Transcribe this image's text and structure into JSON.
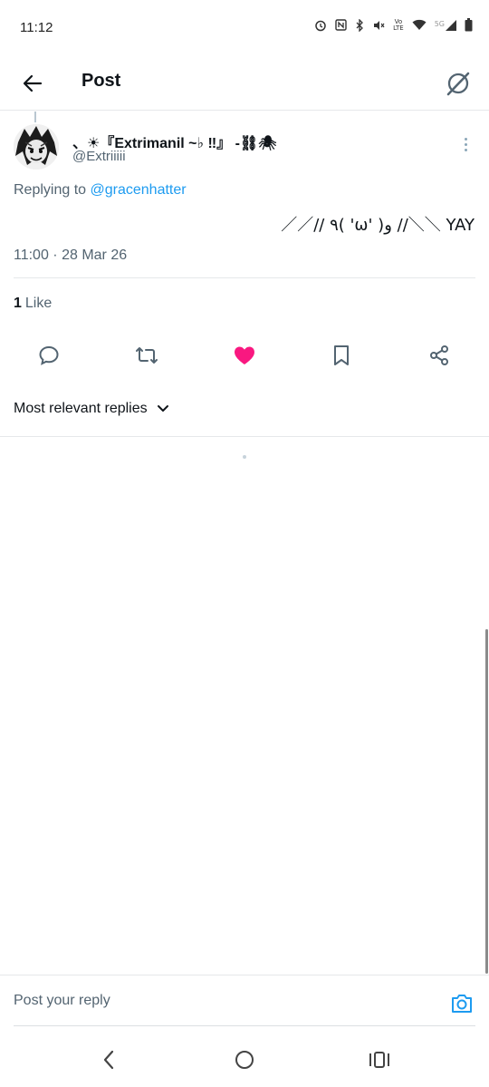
{
  "status_bar": {
    "time": "11:12",
    "volte_top": "Vo",
    "volte_bottom": "LTE",
    "network_label": "5G",
    "icons": [
      "alarm-icon",
      "nfc-icon",
      "bluetooth-icon",
      "mute-icon",
      "volte-icon",
      "wifi-icon",
      "signal-icon",
      "battery-icon"
    ]
  },
  "header": {
    "title": "Post",
    "back_icon": "arrow-left-icon",
    "grok_icon": "grok-icon"
  },
  "tweet": {
    "author_name": "、☀『Extrimanil ~♭ ‼』 -⛓🕷",
    "author_handle": "@Extriiiii",
    "replying_prefix": "Replying to ",
    "replying_to": "@gracenhatter",
    "text": "／／// ٩( 'ω' )و //＼＼ YAY",
    "timestamp": "11:00 · 28 Mar 26",
    "likes_count": "1",
    "likes_label": "Like",
    "liked": true
  },
  "actions": [
    {
      "name": "reply",
      "icon": "comment-icon"
    },
    {
      "name": "repost",
      "icon": "repost-icon"
    },
    {
      "name": "like",
      "icon": "heart-filled-icon"
    },
    {
      "name": "bookmark",
      "icon": "bookmark-icon"
    },
    {
      "name": "share",
      "icon": "share-icon"
    }
  ],
  "sort": {
    "label": "Most relevant replies"
  },
  "reply_bar": {
    "placeholder": "Post your reply"
  },
  "colors": {
    "accent": "#1d9bf0",
    "like": "#f91880",
    "text_primary": "#0f1419",
    "text_secondary": "#536471",
    "divider": "#e6e8ea"
  }
}
